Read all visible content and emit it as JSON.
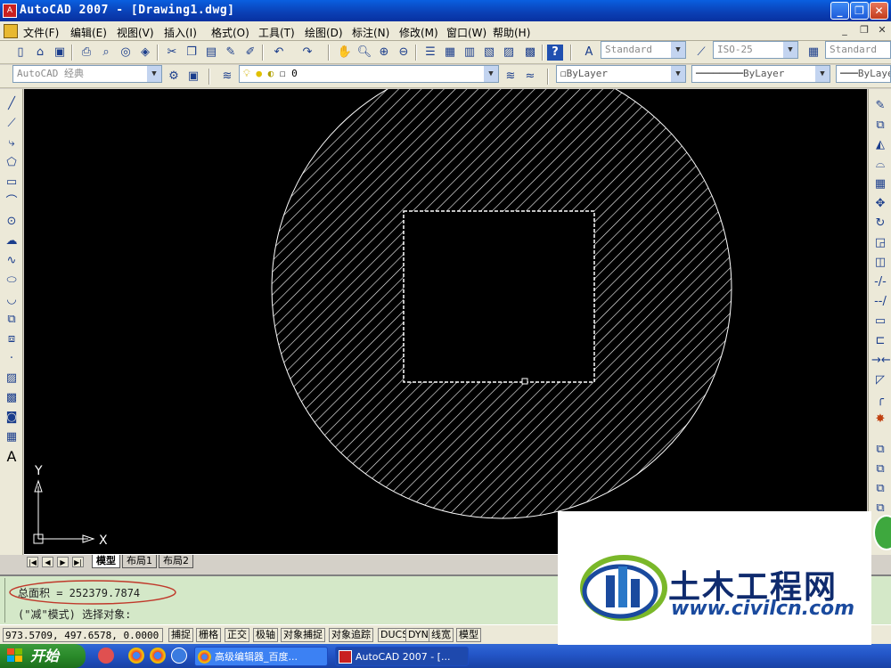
{
  "window": {
    "title": "AutoCAD 2007 - [Drawing1.dwg]",
    "minimize": "_",
    "restore": "❐",
    "close": "✕"
  },
  "menu": {
    "items": [
      "文件(F)",
      "编辑(E)",
      "视图(V)",
      "插入(I)",
      "格式(O)",
      "工具(T)",
      "绘图(D)",
      "标注(N)",
      "修改(M)",
      "窗口(W)",
      "帮助(H)"
    ],
    "doc_controls": [
      "_",
      "❐",
      "✕"
    ]
  },
  "toolbar1": {
    "text_style": "Standard",
    "dim_style": "ISO-25",
    "table_style": "Standard"
  },
  "toolbar2": {
    "workspace": "AutoCAD 经典",
    "layer": "0",
    "color": "ByLayer",
    "linetype": "ByLayer",
    "lineweight": "ByLayer"
  },
  "left_tools": [
    "line-icon",
    "construction-line-icon",
    "polyline-icon",
    "polygon-icon",
    "rectangle-icon",
    "arc-icon",
    "circle-icon",
    "revcloud-icon",
    "spline-icon",
    "ellipse-icon",
    "ellipse-arc-icon",
    "insert-block-icon",
    "make-block-icon",
    "point-icon",
    "hatch-icon",
    "gradient-icon",
    "region-icon",
    "table-icon",
    "mtext-icon"
  ],
  "right_tools": [
    "erase-icon",
    "copy-icon",
    "mirror-icon",
    "offset-icon",
    "array-icon",
    "move-icon",
    "rotate-icon",
    "scale-icon",
    "stretch-icon",
    "trim-icon",
    "extend-icon",
    "break-point-icon",
    "break-icon",
    "join-icon",
    "chamfer-icon",
    "fillet-icon",
    "explode-icon"
  ],
  "ucs": {
    "y_label": "Y",
    "x_label": "X"
  },
  "tabs": {
    "items": [
      "模型",
      "布局1",
      "布局2"
    ],
    "active": 0
  },
  "command": {
    "line1": "总面积 = 252379.7874",
    "line2": "(\"减\"模式) 选择对象:"
  },
  "status": {
    "coords": "973.5709,  497.6578, 0.0000",
    "buttons": [
      "捕捉",
      "栅格",
      "正交",
      "极轴",
      "对象捕捉",
      "对象追踪",
      "DUCS",
      "DYN",
      "线宽",
      "模型"
    ]
  },
  "taskbar": {
    "start": "开始",
    "tasks": [
      "高级编辑器_百度...",
      "AutoCAD 2007 - [..."
    ]
  },
  "watermark": {
    "title": "土木工程网",
    "url": "www.civilcn.com"
  },
  "colors": {
    "canvas": "#000000",
    "hatch": "#ffffff",
    "selection_dash": "#ffffff",
    "command_bg": "#d4e8c8",
    "annotation_ellipse": "#c0392b",
    "titlebar": "#0a3fb4"
  }
}
